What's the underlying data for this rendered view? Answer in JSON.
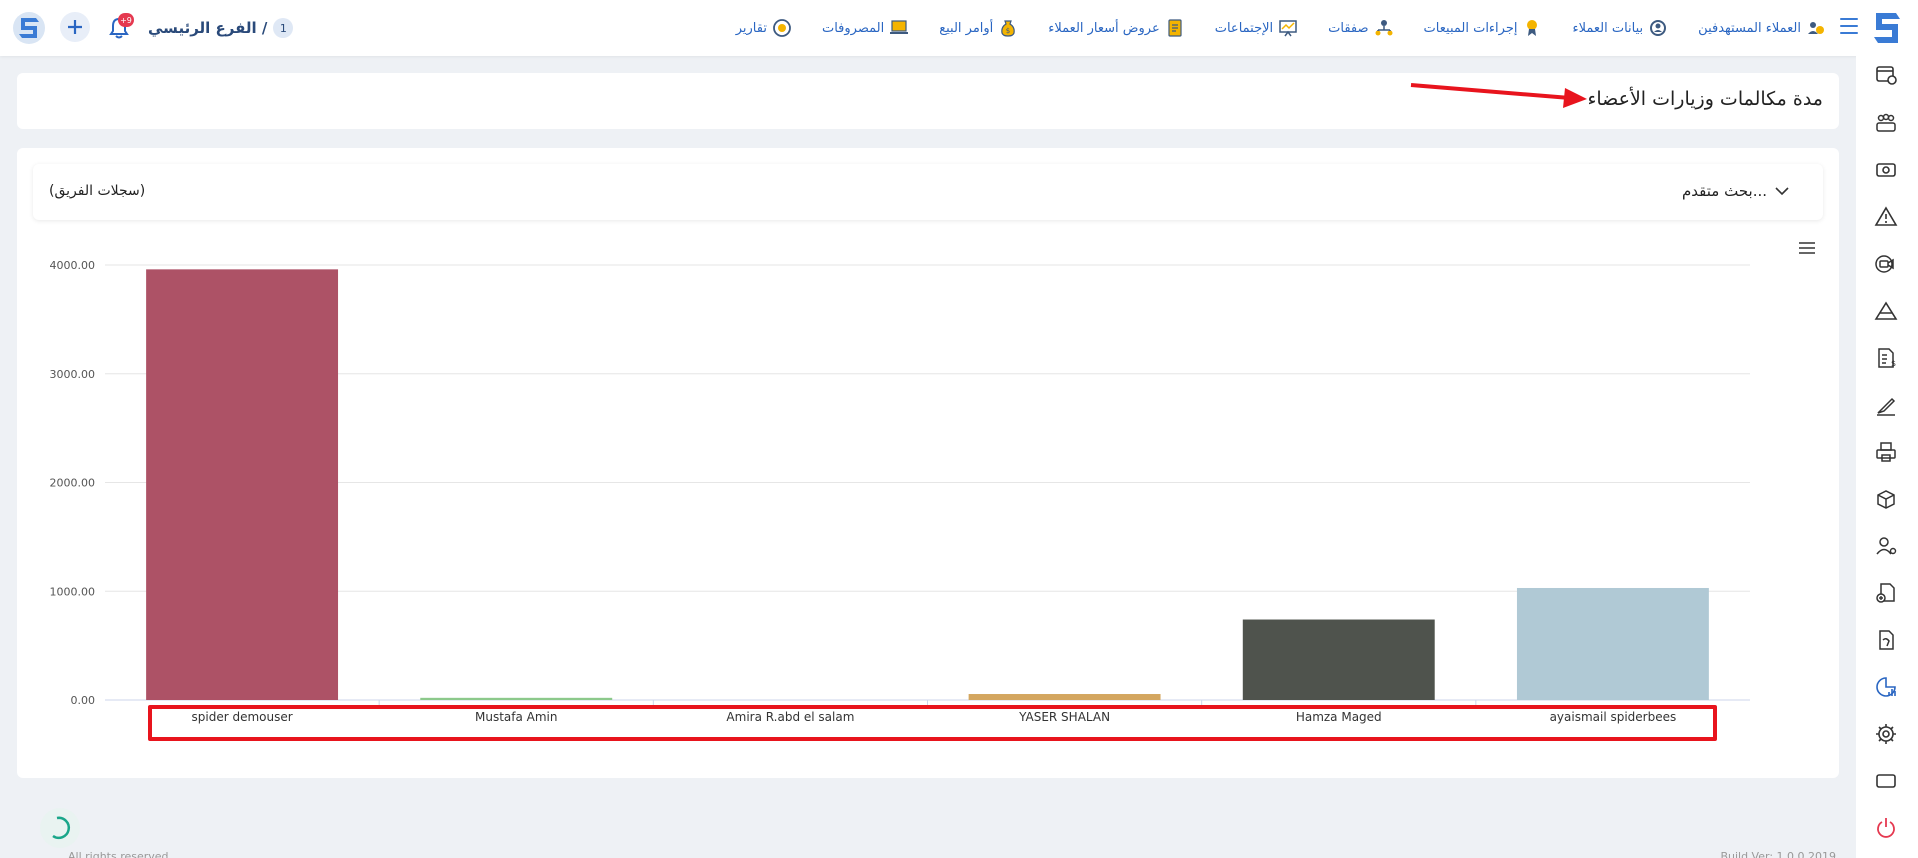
{
  "header": {
    "nav": [
      {
        "label": "العملاء المستهدفين",
        "icon": "target-customers-icon"
      },
      {
        "label": "بيانات العملاء",
        "icon": "customer-data-icon"
      },
      {
        "label": "إجراءات المبيعات",
        "icon": "sales-actions-icon"
      },
      {
        "label": "صفقات",
        "icon": "deals-icon"
      },
      {
        "label": "الإجتماعات",
        "icon": "meetings-icon"
      },
      {
        "label": "عروض أسعار العملاء",
        "icon": "quotes-icon"
      },
      {
        "label": "أوامر البيع",
        "icon": "sales-orders-icon"
      },
      {
        "label": "المصروفات",
        "icon": "expenses-icon"
      },
      {
        "label": "تقارير",
        "icon": "reports-icon"
      }
    ],
    "branch_number": "1",
    "branch_label": "الفرع الرئيسي /",
    "notification_count": "+9"
  },
  "page": {
    "title": "مدة مكالمات وزيارات الأعضاء",
    "advanced_search": "بحث متقدم...",
    "team_records": "(سجلات الفريق)"
  },
  "chart_data": {
    "type": "bar",
    "categories": [
      "spider demouser",
      "Mustafa Amin",
      "Amira R.abd el salam",
      "YASER SHALAN",
      "Hamza Maged",
      "ayaismail spiderbees"
    ],
    "values": [
      3960,
      20,
      0,
      55,
      740,
      1030
    ],
    "colors": [
      "#ad5266",
      "#8cc98b",
      "#9bb3c7",
      "#d4a65f",
      "#4f534d",
      "#b0c9d5"
    ],
    "yticks": [
      "0.00",
      "1000.00",
      "2000.00",
      "3000.00",
      "4000.00"
    ],
    "ylim": [
      0,
      4000
    ],
    "grid": true
  },
  "sidebar_icons": [
    "card-settings-icon",
    "team-icon",
    "money-icon",
    "warning-icon",
    "video-call-icon",
    "mountain-icon",
    "invoice-icon",
    "signature-icon",
    "printer-icon",
    "box-icon",
    "user-settings-icon",
    "add-document-icon",
    "document-hand-icon",
    "chart-report-icon",
    "gear-icon",
    "window-icon",
    "power-icon"
  ],
  "footer": {
    "left": "All rights reserved",
    "right": "Build Ver: 1.0.0 2019"
  }
}
